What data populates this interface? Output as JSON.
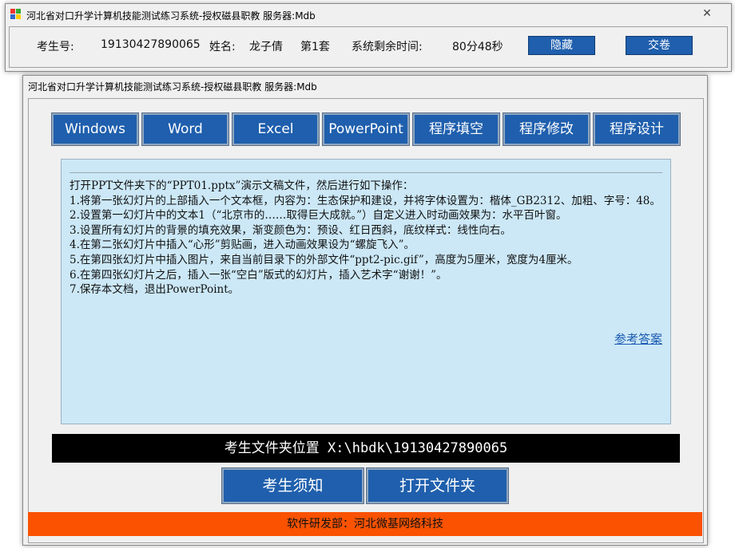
{
  "top_window": {
    "title": "河北省对口升学计算机技能测试练习系统-授权磁县职教  服务器:Mdb",
    "close_symbol": "✕",
    "exam_id_label": "考生号:",
    "exam_id_value": "19130427890065",
    "name_label": "姓名:",
    "name_value": "龙子倩",
    "set_label": "第1套",
    "time_label": "系统剩余时间:",
    "time_value": "80分48秒",
    "hide_button": "隐藏",
    "submit_button": "交卷"
  },
  "main_window": {
    "title": "河北省对口升学计算机技能测试练习系统-授权磁县职教  服务器:Mdb",
    "tabs": [
      {
        "label": "Windows"
      },
      {
        "label": "Word"
      },
      {
        "label": "Excel"
      },
      {
        "label": "PowerPoint"
      },
      {
        "label": "程序填空"
      },
      {
        "label": "程序修改"
      },
      {
        "label": "程序设计"
      }
    ],
    "content": {
      "lines": [
        "打开PPT文件夹下的“PPT01.pptx”演示文稿文件，然后进行如下操作：",
        "1.将第一张幻灯片的上部插入一个文本框，内容为：生态保护和建设，并将字体设置为：楷体_GB2312、加粗、字号：48。",
        "2.设置第一幻灯片中的文本1（“北京市的……取得巨大成就。”）自定义进入时动画效果为：水平百叶窗。",
        "3.设置所有幻灯片的背景的填充效果，渐变颜色为：预设、红日西斜，底纹样式：线性向右。",
        "4.在第二张幻灯片中插入“心形”剪贴画，进入动画效果设为“螺旋飞入”。",
        "5.在第四张幻灯片中插入图片，来自当前目录下的外部文件“ppt2-pic.gif”，高度为5厘米，宽度为4厘米。",
        "6.在第四张幻灯片之后，插入一张“空白”版式的幻灯片，插入艺术字“谢谢！”。",
        "7.保存本文档，退出PowerPoint。"
      ],
      "ref_link": "参考答案"
    },
    "folder_path": "考生文件夹位置 X:\\hbdk\\19130427890065",
    "notice_button": "考生须知",
    "open_folder_button": "打开文件夹",
    "footer": "软件研发部：河北微基网络科技"
  },
  "colors": {
    "button_blue": "#1f5fad",
    "content_bg": "#cce8f7",
    "footer_orange": "#fa5200",
    "link_blue": "#1a5ab0"
  }
}
